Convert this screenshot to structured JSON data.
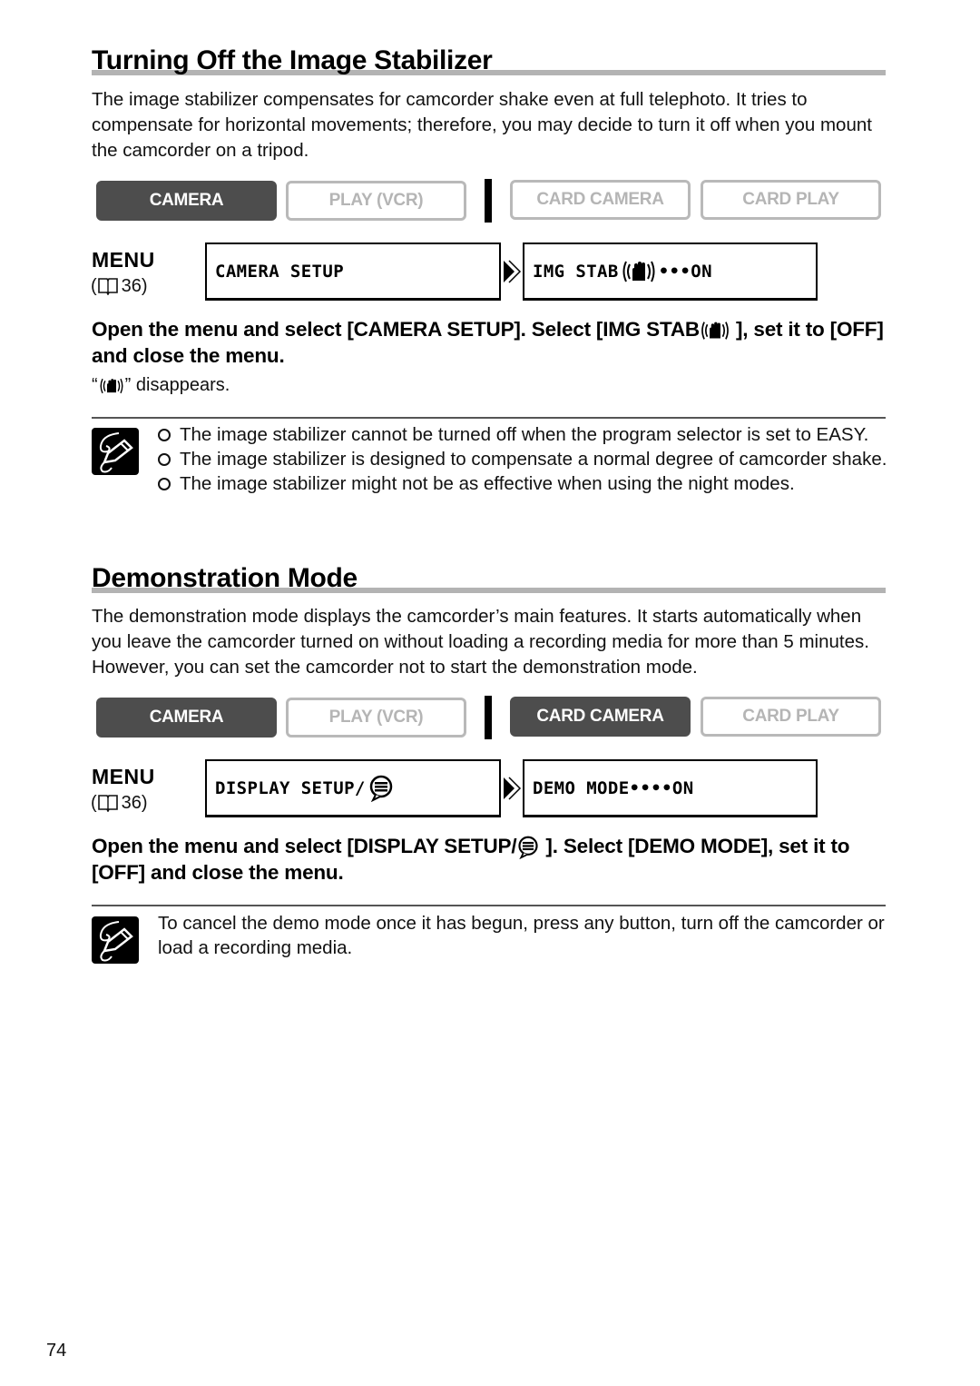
{
  "sections": [
    {
      "title": "Turning Off the Image Stabilizer",
      "intro": "The image stabilizer compensates for camcorder shake even at full telephoto. It tries to compensate for horizontal movements; therefore, you may decide to turn it off when you mount the camcorder on a tripod.",
      "modes": [
        {
          "label": "CAMERA",
          "active": true
        },
        {
          "label": "PLAY (VCR)",
          "active": false
        },
        {
          "label": "CARD CAMERA",
          "active": false
        },
        {
          "label": "CARD PLAY",
          "active": false
        }
      ],
      "menu": {
        "label": "MENU",
        "ref_page": "36)",
        "ref_open": "(",
        "step1": "CAMERA SETUP",
        "step2_prefix": "IMG STAB",
        "step2_suffix": "•••ON",
        "step2_icon": "hand-stabilizer-icon"
      },
      "instruction_part1": "Open the menu and select [CAMERA SETUP]. Select [IMG STAB",
      "instruction_part2": " ], set it to [OFF] and close the menu.",
      "result_open": "“",
      "result_close": "” disappears.",
      "notes_icon": "pencil-note-icon",
      "notes": [
        "The image stabilizer cannot be turned off when the program selector is set to EASY.",
        "The image stabilizer is designed to compensate a normal degree of camcorder shake.",
        "The image stabilizer might not be as effective when using the night modes."
      ]
    },
    {
      "title": "Demonstration Mode",
      "intro": "The demonstration mode displays the camcorder’s main features. It starts automatically when you leave the camcorder turned on without loading a recording media for more than 5 minutes. However, you can set the camcorder not to start the demonstration mode.",
      "modes": [
        {
          "label": "CAMERA",
          "active": true
        },
        {
          "label": "PLAY (VCR)",
          "active": false
        },
        {
          "label": "CARD CAMERA",
          "active": true
        },
        {
          "label": "CARD PLAY",
          "active": false
        }
      ],
      "menu": {
        "label": "MENU",
        "ref_page": "36)",
        "ref_open": "(",
        "step1": "DISPLAY SETUP/",
        "step1_icon": "speech-bubble-icon",
        "step2": "DEMO MODE••••ON"
      },
      "instruction_part1": "Open the menu and select [DISPLAY SETUP/",
      "instruction_part2": " ]. Select [DEMO MODE], set it to [OFF] and close the menu.",
      "notes_icon": "pencil-note-icon",
      "note": "To cancel the demo mode once it has begun, press any button, turn off the camcorder or load a recording media."
    }
  ],
  "page_number": "74",
  "colors": {
    "active_mode": "#4d4d4d",
    "inactive_mode_border": "#b9b9b9",
    "inactive_mode_text": "#b5b5b5",
    "title_rule": "#b3b3b3"
  }
}
